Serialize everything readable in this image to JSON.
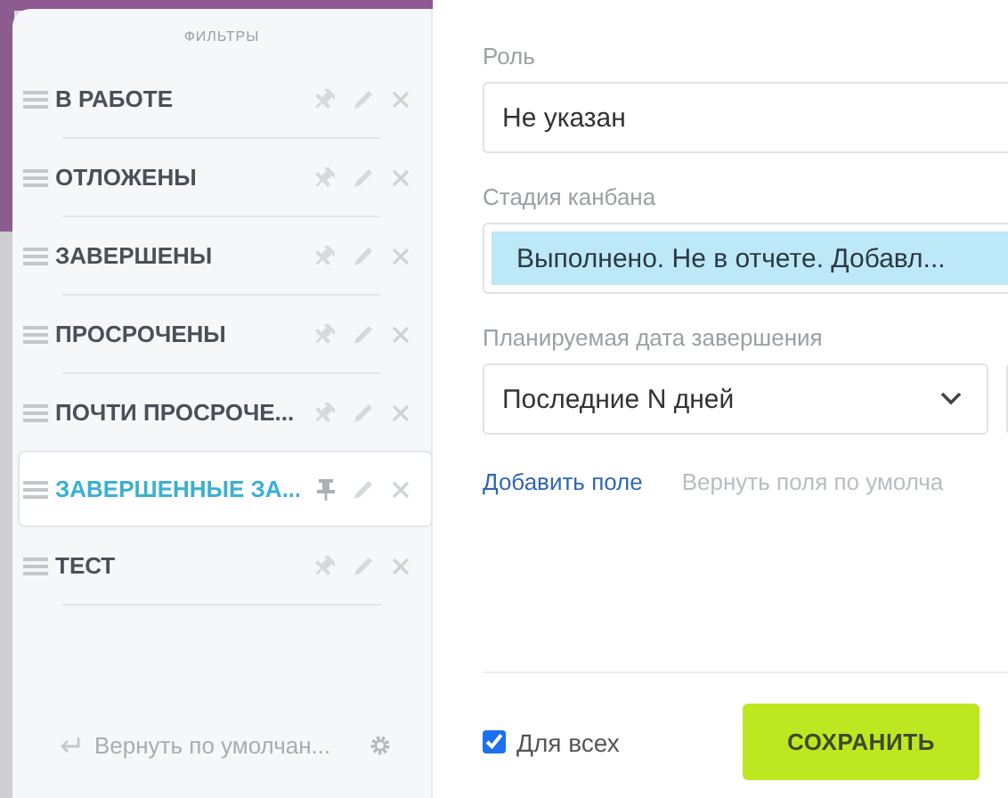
{
  "sidebar": {
    "title": "ФИЛЬТРЫ",
    "items": [
      {
        "label": "В РАБОТЕ",
        "selected": false,
        "pinned": false
      },
      {
        "label": "ОТЛОЖЕНЫ",
        "selected": false,
        "pinned": false
      },
      {
        "label": "ЗАВЕРШЕНЫ",
        "selected": false,
        "pinned": false
      },
      {
        "label": "ПРОСРОЧЕНЫ",
        "selected": false,
        "pinned": false
      },
      {
        "label": "ПОЧТИ ПРОСРОЧЕ...",
        "selected": false,
        "pinned": false
      },
      {
        "label": "ЗАВЕРШЕННЫЕ ЗА...",
        "selected": true,
        "pinned": true
      },
      {
        "label": "ТЕСТ",
        "selected": false,
        "pinned": false
      }
    ],
    "reset": "Вернуть по умолчан..."
  },
  "form": {
    "fields": [
      {
        "kind": "text",
        "label": "Роль",
        "value": "Не указан"
      },
      {
        "kind": "tags",
        "label": "Стадия канбана",
        "value": "Выполнено. Не в отчете. Добавл..."
      },
      {
        "kind": "select",
        "label": "Планируемая дата завершения",
        "value": "Последние N дней"
      }
    ],
    "add_field": "Добавить поле",
    "reset_fields": "Вернуть поля по умолча",
    "for_all": {
      "label": "Для всех",
      "checked": true
    },
    "save": "СОХРАНИТЬ"
  }
}
